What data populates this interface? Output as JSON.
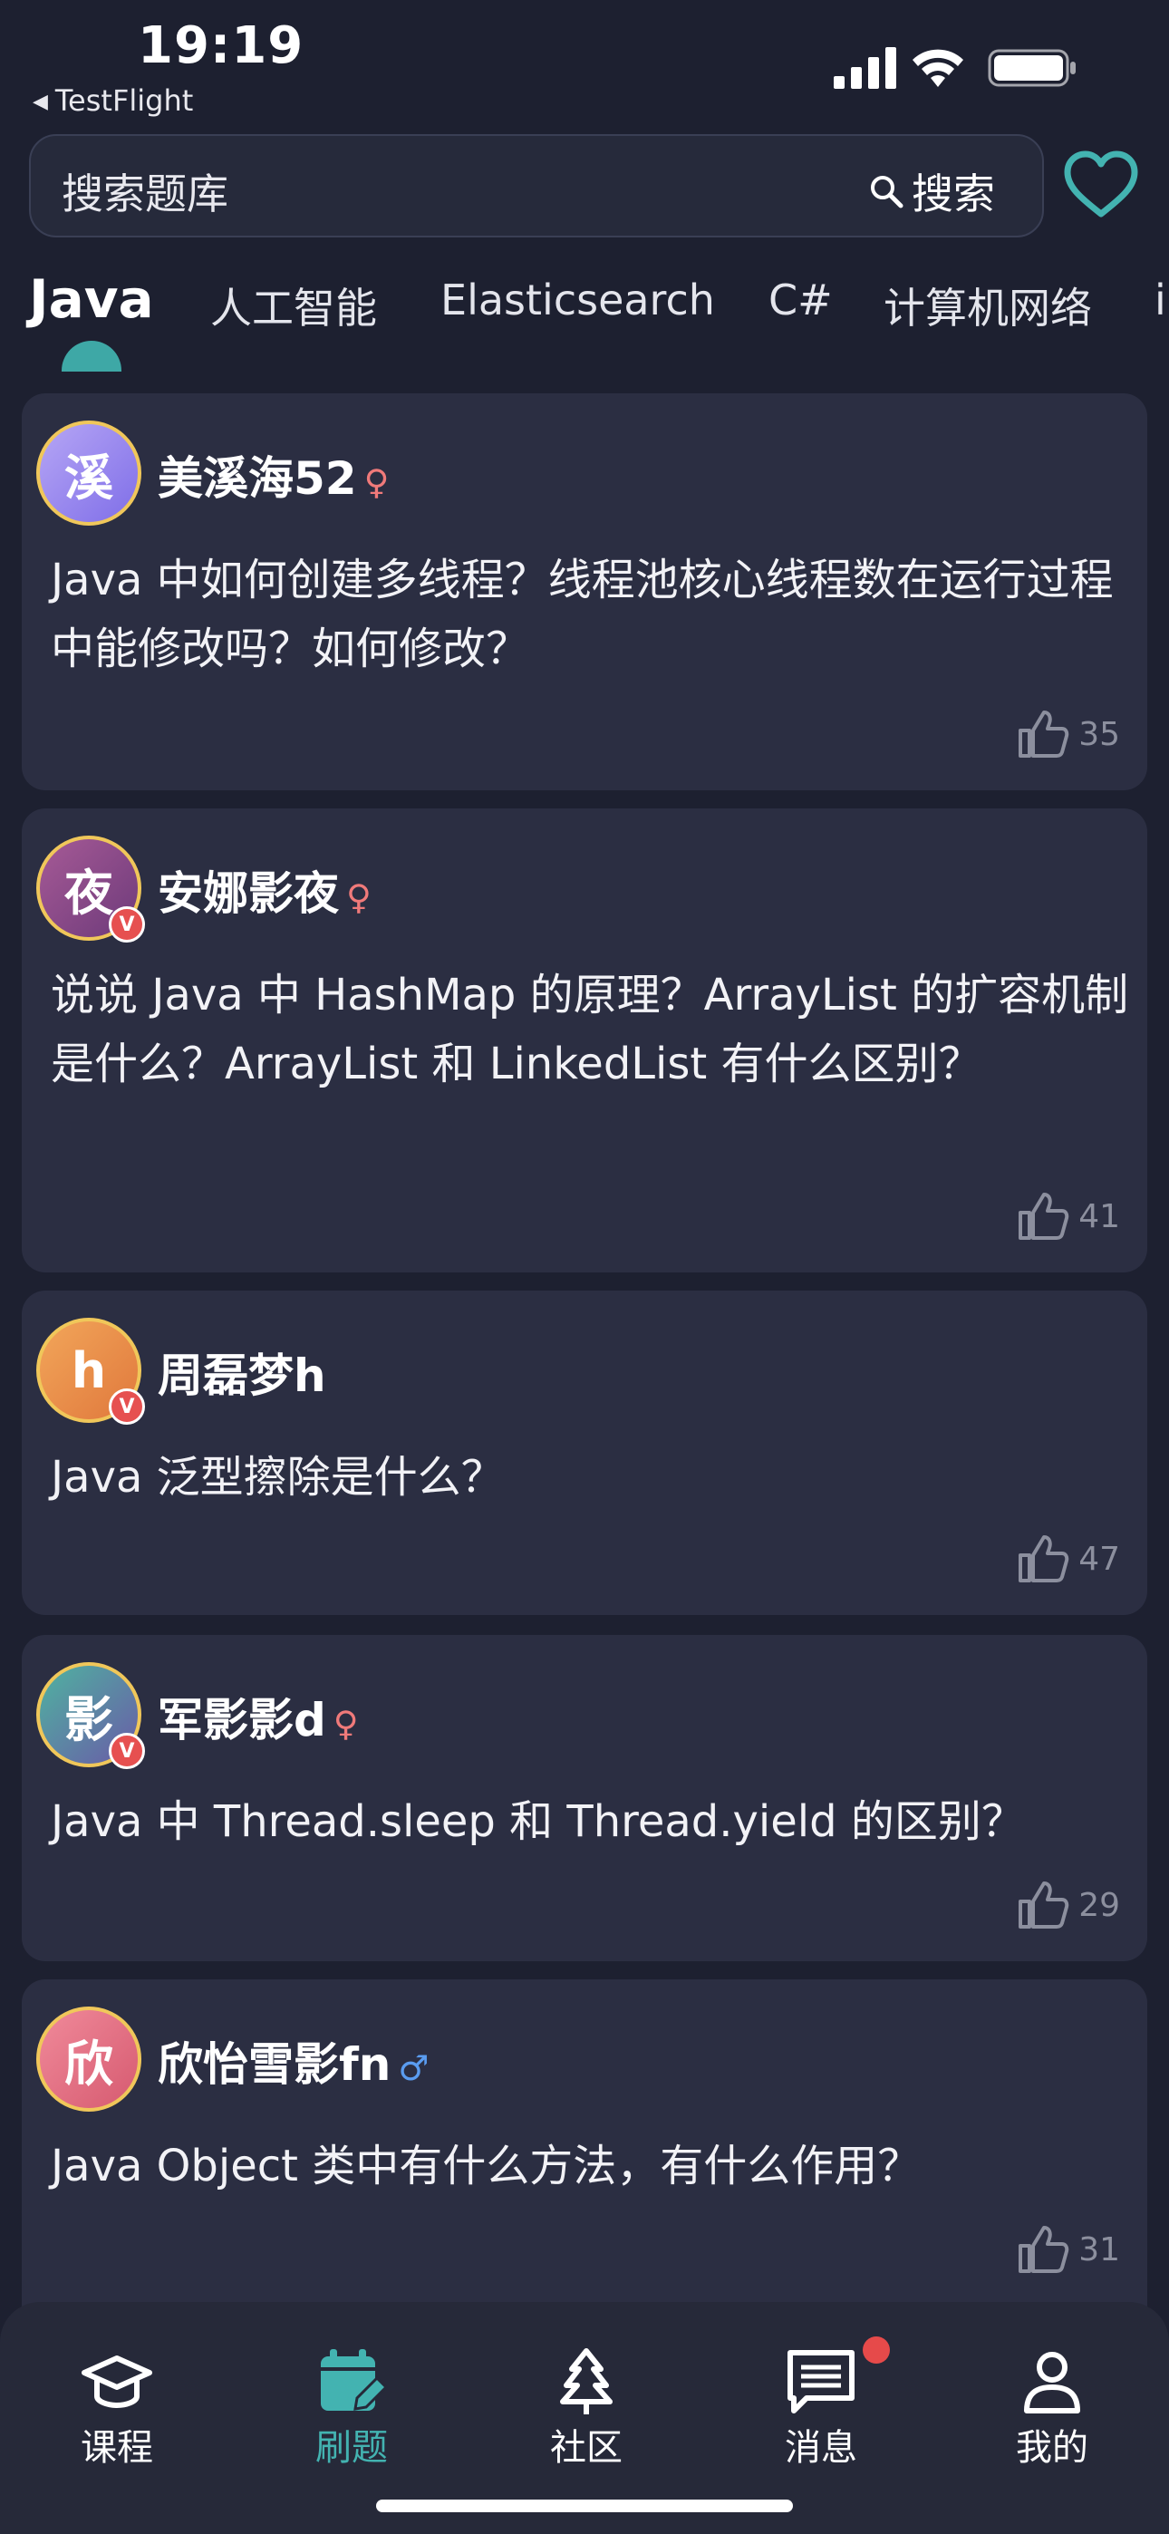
{
  "status_bar": {
    "time": "19:19",
    "back_app": "TestFlight",
    "icons": [
      "signal-icon",
      "wifi-icon",
      "battery-icon"
    ]
  },
  "search": {
    "placeholder": "搜索题库",
    "button_label": "搜索"
  },
  "tabs": [
    {
      "label": "Java",
      "active": true
    },
    {
      "label": "人工智能",
      "active": false
    },
    {
      "label": "Elasticsearch",
      "active": false
    },
    {
      "label": "C#",
      "active": false
    },
    {
      "label": "计算机网络",
      "active": false
    },
    {
      "label": "i",
      "active": false
    }
  ],
  "posts": [
    {
      "avatar_char": "溪",
      "username": "美溪海52",
      "gender": "♀",
      "verified": false,
      "question": "Java 中如何创建多线程？线程池核心线程数在运行过程中能修改吗？如何修改？",
      "likes": "35"
    },
    {
      "avatar_char": "夜",
      "username": "安娜影夜",
      "gender": "♀",
      "verified": true,
      "question": "说说 Java 中 HashMap 的原理？ArrayList 的扩容机制是什么？ArrayList 和 LinkedList 有什么区别？",
      "likes": "41"
    },
    {
      "avatar_char": "h",
      "username": "周磊梦h",
      "gender": "",
      "verified": true,
      "question": "Java 泛型擦除是什么？",
      "likes": "47"
    },
    {
      "avatar_char": "影",
      "username": "军影影d",
      "gender": "♀",
      "verified": true,
      "question": "Java 中 Thread.sleep 和 Thread.yield 的区别？",
      "likes": "29"
    },
    {
      "avatar_char": "欣",
      "username": "欣怡雪影fn",
      "gender": "♂",
      "verified": false,
      "question": "Java Object 类中有什么方法，有什么作用？",
      "likes": "31"
    }
  ],
  "bottom_nav": [
    {
      "label": "课程",
      "icon": "graduation-cap-icon",
      "active": false
    },
    {
      "label": "刷题",
      "icon": "calendar-edit-icon",
      "active": true
    },
    {
      "label": "社区",
      "icon": "tree-icon",
      "active": false
    },
    {
      "label": "消息",
      "icon": "message-icon",
      "active": false,
      "has_notification": true
    },
    {
      "label": "我的",
      "icon": "user-icon",
      "active": false
    }
  ],
  "colors": {
    "background": "#1d2030",
    "card": "#2b2e42",
    "accent": "#43b3b1",
    "female": "#f07a7a",
    "male": "#5a9cf0",
    "notification": "#e64a4a"
  }
}
